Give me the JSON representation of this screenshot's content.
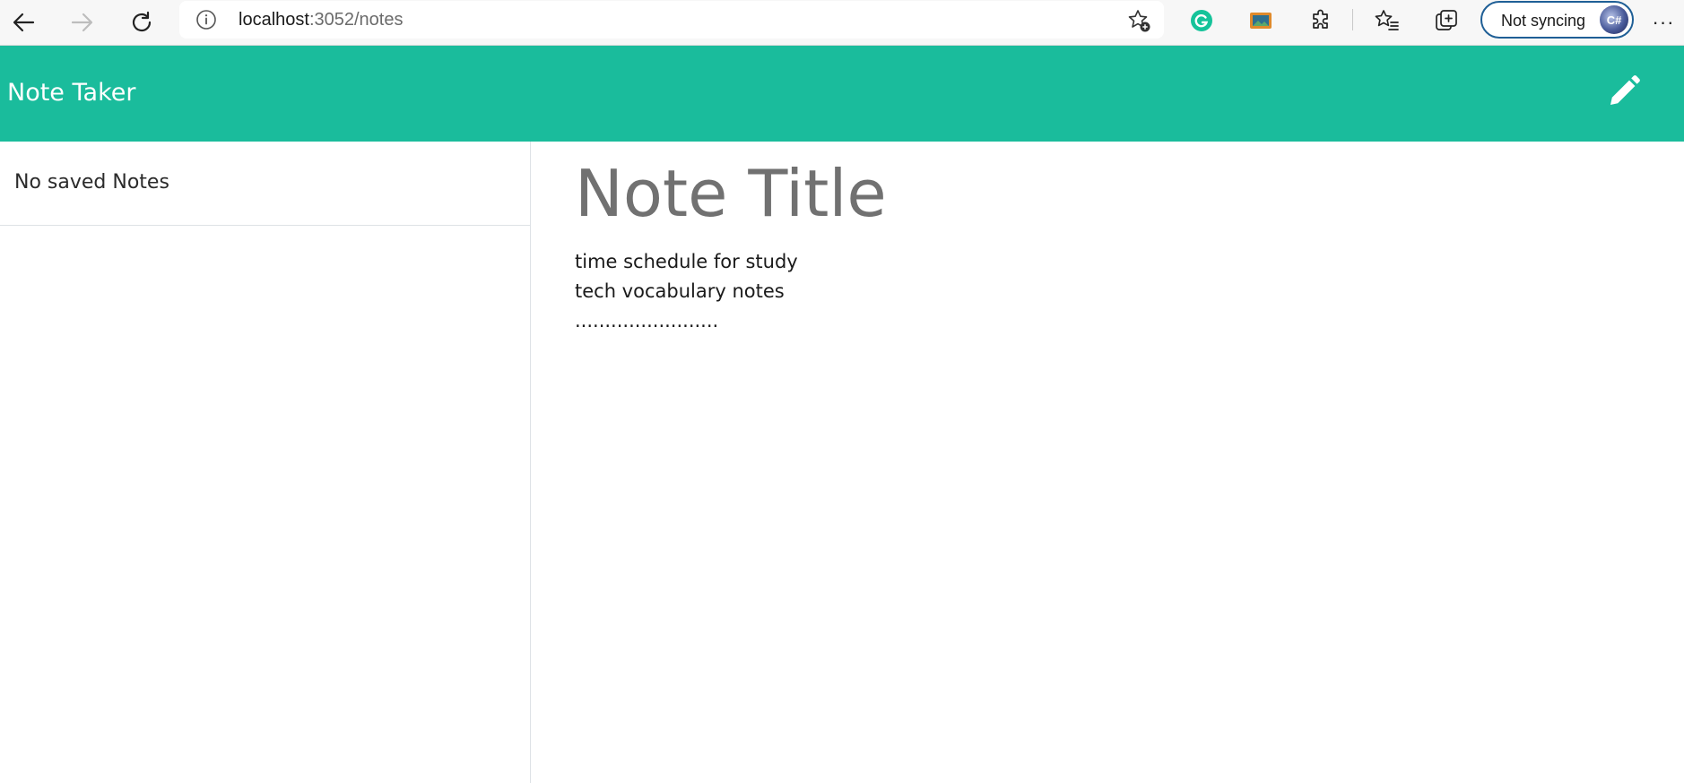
{
  "browser": {
    "url_host": "localhost",
    "url_path": ":3052/notes",
    "profile_label": "Not syncing",
    "profile_avatar_text": "C#",
    "more_label": "···",
    "icons": {
      "back": "back-arrow-icon",
      "forward": "forward-arrow-icon",
      "reload": "reload-icon",
      "site_info": "info-icon",
      "add_favorite": "star-plus-icon",
      "grammarly": "grammarly-icon",
      "extension_image": "picture-icon",
      "extensions": "puzzle-icon",
      "favorites": "star-list-icon",
      "collections": "collections-icon",
      "more": "more-dots-icon"
    }
  },
  "header": {
    "title": "Note Taker",
    "new_note_icon": "pencil-icon",
    "background_color": "#1abc9c"
  },
  "sidebar": {
    "items": [
      {
        "label": "No saved Notes"
      }
    ]
  },
  "editor": {
    "title_placeholder": "Note Title",
    "title_value": "",
    "body_value": "time schedule for study\ntech vocabulary notes\n........................"
  }
}
